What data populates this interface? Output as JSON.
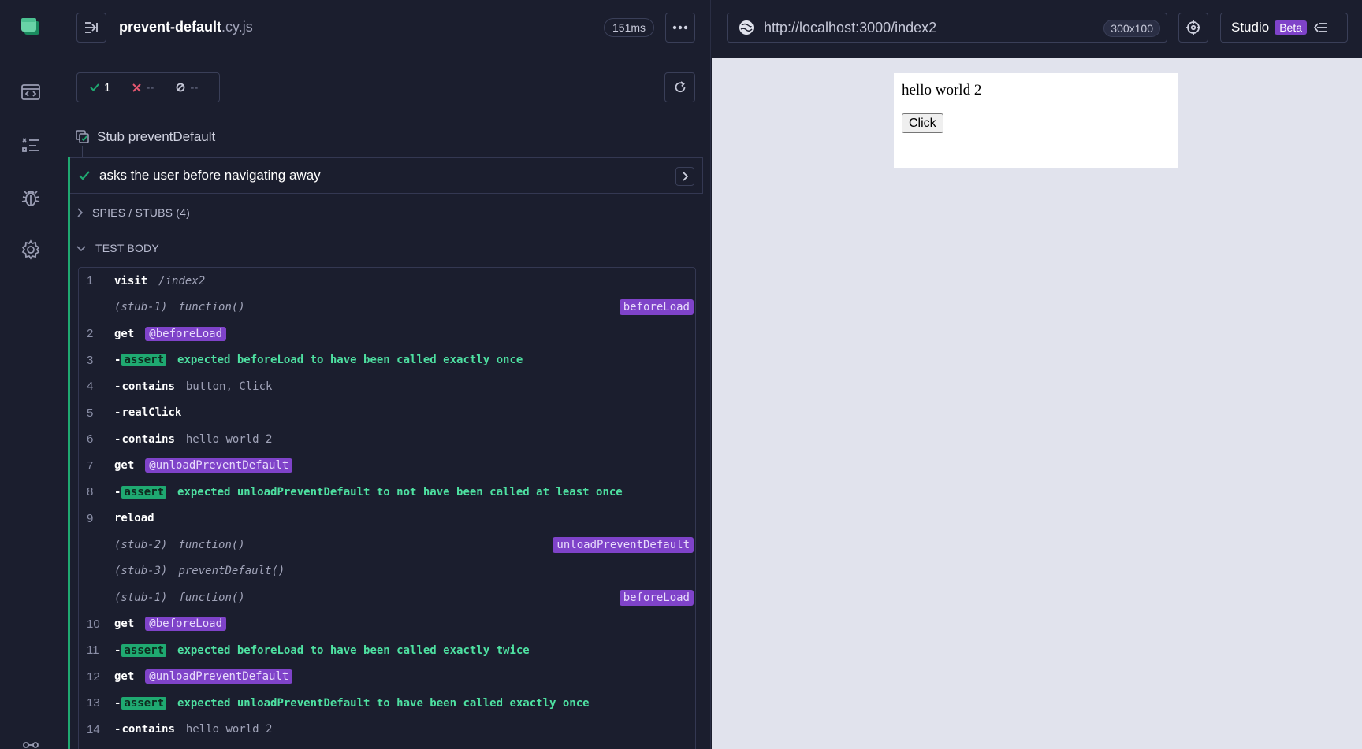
{
  "reporter": {
    "spec_name": "prevent-default",
    "spec_ext": ".cy.js",
    "duration": "151ms",
    "stats": {
      "passed": "1",
      "failed": "--",
      "pending": "--"
    },
    "suite_title": "Stub preventDefault",
    "test_title": "asks the user before navigating away",
    "sections": {
      "spies": "SPIES / STUBS (4)",
      "body": "TEST BODY"
    },
    "commands": [
      {
        "ln": "1",
        "dash": "",
        "name": "visit",
        "msg": "/index2",
        "type": "plain"
      },
      {
        "ln": "",
        "stub": "(stub-1)",
        "fn": "function()",
        "tag": "beforeLoad",
        "type": "stub"
      },
      {
        "ln": "2",
        "name": "get",
        "alias": "@beforeLoad",
        "type": "alias"
      },
      {
        "ln": "3",
        "dash": "-",
        "badge": "assert",
        "msg": "expected beforeLoad to have been called exactly once",
        "type": "assert"
      },
      {
        "ln": "4",
        "dash": "-",
        "name": "contains",
        "msg": "button, Click",
        "type": "plain"
      },
      {
        "ln": "5",
        "dash": "-",
        "name": "realClick",
        "msg": "",
        "type": "plain"
      },
      {
        "ln": "6",
        "dash": "-",
        "name": "contains",
        "msg": "hello world 2",
        "type": "plain"
      },
      {
        "ln": "7",
        "name": "get",
        "alias": "@unloadPreventDefault",
        "type": "alias"
      },
      {
        "ln": "8",
        "dash": "-",
        "badge": "assert",
        "msg": "expected unloadPreventDefault to not have been called at least once",
        "type": "assert"
      },
      {
        "ln": "9",
        "dash": "",
        "name": "reload",
        "msg": "",
        "type": "plain"
      },
      {
        "ln": "",
        "stub": "(stub-2)",
        "fn": "function()",
        "tag": "unloadPreventDefault",
        "type": "stub"
      },
      {
        "ln": "",
        "stub": "(stub-3)",
        "fn": "preventDefault()",
        "tag": "",
        "type": "stub"
      },
      {
        "ln": "",
        "stub": "(stub-1)",
        "fn": "function()",
        "tag": "beforeLoad",
        "type": "stub"
      },
      {
        "ln": "10",
        "name": "get",
        "alias": "@beforeLoad",
        "type": "alias"
      },
      {
        "ln": "11",
        "dash": "-",
        "badge": "assert",
        "msg": "expected beforeLoad to have been called exactly twice",
        "type": "assert"
      },
      {
        "ln": "12",
        "name": "get",
        "alias": "@unloadPreventDefault",
        "type": "alias"
      },
      {
        "ln": "13",
        "dash": "-",
        "badge": "assert",
        "msg": "expected unloadPreventDefault to have been called exactly once",
        "type": "assert"
      },
      {
        "ln": "14",
        "dash": "-",
        "name": "contains",
        "msg": "hello world 2",
        "type": "plain"
      }
    ]
  },
  "aut": {
    "url": "http://localhost:3000/index2",
    "viewport": "300x100",
    "studio_label": "Studio",
    "studio_badge": "Beta",
    "page": {
      "heading": "hello world 2",
      "button": "Click"
    }
  },
  "colors": {
    "pass": "#1fa971",
    "fail": "#e45770",
    "alias": "#7f43c9",
    "background": "#1b1e2e",
    "aut_bg": "#e1e3ed"
  },
  "icons": [
    "cypress-logo-icon",
    "specs-icon",
    "runs-icon",
    "debug-icon",
    "settings-icon",
    "collapse-icon",
    "more-icon",
    "check-icon",
    "x-icon",
    "pending-icon",
    "refresh-icon",
    "suite-icon",
    "chevron-right-icon",
    "chevron-down-icon",
    "globe-icon",
    "crosshair-icon",
    "studio-collapse-icon"
  ]
}
